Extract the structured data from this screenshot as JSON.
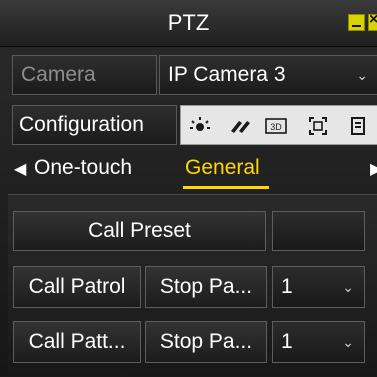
{
  "window": {
    "title": "PTZ",
    "accent": "#ffd800"
  },
  "camera": {
    "label": "Camera",
    "value": "IP Camera 3"
  },
  "configuration": {
    "label": "Configuration"
  },
  "toolbar_icons": [
    "light-bulb-icon",
    "wiper-icon",
    "3d-zoom-icon",
    "lens-init-icon",
    "menu-icon"
  ],
  "toolbar_3d": "3D",
  "tabs": {
    "one_touch": "One-touch",
    "general": "General"
  },
  "general": {
    "call_preset": "Call Preset",
    "call_patrol": "Call Patrol",
    "stop_patrol": "Stop Pa...",
    "patrol_value": "1",
    "call_pattern": "Call Patt...",
    "stop_pattern": "Stop Pa...",
    "pattern_value": "1"
  }
}
